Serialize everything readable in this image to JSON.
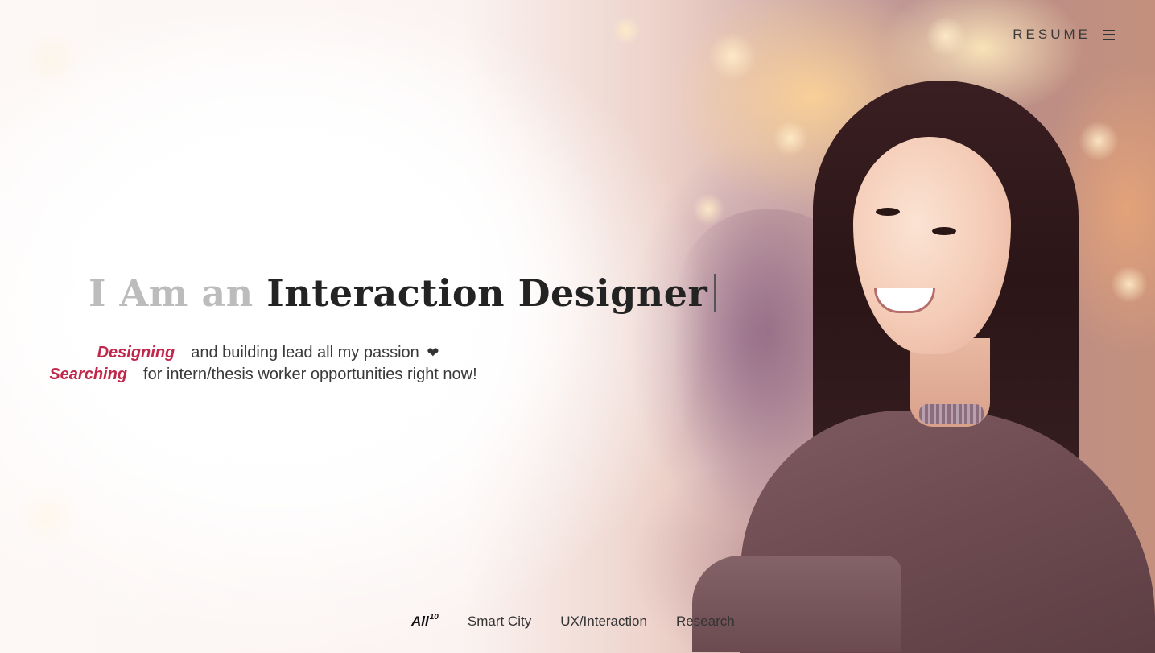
{
  "nav": {
    "resume_label": "RESUME",
    "menu_icon": "hamburger-menu-icon"
  },
  "hero": {
    "headline_prefix": "I Am an",
    "headline_role": "Interaction Designer",
    "line1_accent": "Designing",
    "line1_text": "and building lead all my passion",
    "line1_icon": "heart-icon",
    "line2_accent": "Searching",
    "line2_text": "for intern/thesis worker opportunities right now!"
  },
  "filters": {
    "items": [
      {
        "label": "All",
        "count": "10",
        "active": true
      },
      {
        "label": "Smart City"
      },
      {
        "label": "UX/Interaction"
      },
      {
        "label": "Research"
      }
    ]
  },
  "colors": {
    "accent": "#c1274a",
    "headline_muted": "#bcbcbc",
    "headline_strong": "#232323"
  }
}
